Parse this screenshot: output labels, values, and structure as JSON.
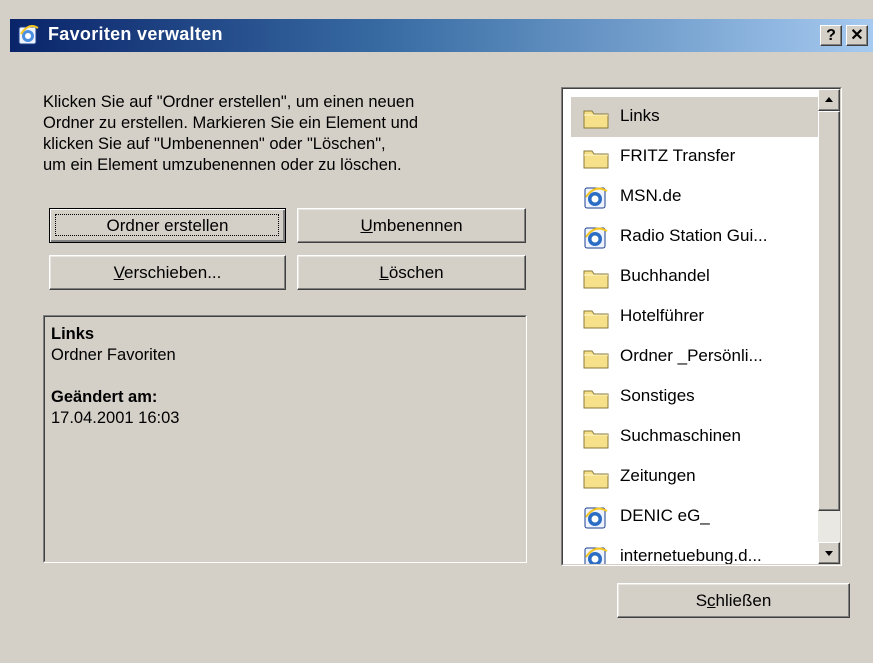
{
  "window": {
    "title": "Favoriten verwalten",
    "help_label": "?",
    "close_label": "✕"
  },
  "instructions": "Klicken Sie auf \"Ordner erstellen\", um einen neuen\nOrdner zu erstellen. Markieren Sie ein Element und\nklicken Sie auf \"Umbenennen\" oder \"Löschen\",\num ein Element umzubenennen oder zu löschen.",
  "buttons": {
    "create_folder": "Ordner erstellen",
    "rename_mnemonic": "U",
    "rename_rest": "mbenennen",
    "move_mnemonic": "V",
    "move_rest": "erschieben...",
    "delete_mnemonic": "L",
    "delete_rest": "öschen",
    "close_pre": "S",
    "close_mnemonic": "c",
    "close_rest": "hließen"
  },
  "info": {
    "name": "Links",
    "type": "Ordner Favoriten",
    "modified_label": "Geändert am:",
    "modified_value": "17.04.2001 16:03"
  },
  "favorites": [
    {
      "label": "Links",
      "icon": "folder-icon",
      "selected": true
    },
    {
      "label": "FRITZ Transfer",
      "icon": "folder-icon"
    },
    {
      "label": "MSN.de",
      "icon": "ie-icon"
    },
    {
      "label": "Radio Station Gui...",
      "icon": "ie-icon"
    },
    {
      "label": "Buchhandel",
      "icon": "folder-icon"
    },
    {
      "label": "Hotelführer",
      "icon": "folder-icon"
    },
    {
      "label": "Ordner _Persönli...",
      "icon": "folder-icon"
    },
    {
      "label": "Sonstiges",
      "icon": "folder-icon"
    },
    {
      "label": "Suchmaschinen",
      "icon": "folder-icon"
    },
    {
      "label": "Zeitungen",
      "icon": "folder-icon"
    },
    {
      "label": "DENIC eG_",
      "icon": "ie-icon"
    },
    {
      "label": "internetuebung.d...",
      "icon": "ie-icon"
    }
  ],
  "colors": {
    "title_start": "#0a246a",
    "title_end": "#a6caf0",
    "face": "#d4d0c8",
    "folder": "#f7e08a",
    "ie_blue": "#2b6cc4"
  }
}
